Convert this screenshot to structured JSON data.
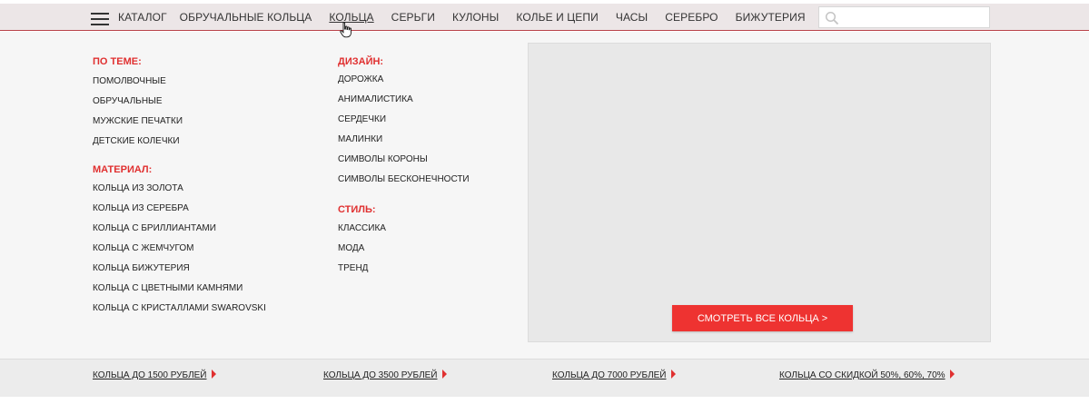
{
  "nav": {
    "catalog_label": "КАТАЛОГ",
    "items": [
      {
        "label": "ОБРУЧАЛЬНЫЕ КОЛЬЦА"
      },
      {
        "label": "КОЛЬЦА"
      },
      {
        "label": "СЕРЬГИ"
      },
      {
        "label": "КУЛОНЫ"
      },
      {
        "label": "КОЛЬЕ И ЦЕПИ"
      },
      {
        "label": "ЧАСЫ"
      },
      {
        "label": "СЕРЕБРО"
      },
      {
        "label": "БИЖУТЕРИЯ"
      }
    ],
    "active_item": "КОЛЬЦА"
  },
  "search": {
    "value": "",
    "placeholder": ""
  },
  "menu": {
    "theme": {
      "heading": "ПО ТЕМЕ:",
      "items": [
        "ПОМОЛВОЧНЫЕ",
        "ОБРУЧАЛЬНЫЕ",
        "МУЖСКИЕ ПЕЧАТКИ",
        "ДЕТСКИЕ КОЛЕЧКИ"
      ]
    },
    "material": {
      "heading": "МАТЕРИАЛ:",
      "items": [
        "КОЛЬЦА ИЗ ЗОЛОТА",
        "КОЛЬЦА ИЗ СЕРЕБРА",
        "КОЛЬЦА С БРИЛЛИАНТАМИ",
        "КОЛЬЦА С ЖЕМЧУГОМ",
        "КОЛЬЦА БИЖУТЕРИЯ",
        "КОЛЬЦА С ЦВЕТНЫМИ КАМНЯМИ",
        "КОЛЬЦА С КРИСТАЛЛАМИ SWAROVSKI"
      ]
    },
    "design": {
      "heading": "ДИЗАЙН:",
      "items": [
        "ДОРОЖКА",
        "АНИМАЛИСТИКА",
        "СЕРДЕЧКИ",
        "МАЛИНКИ",
        "СИМВОЛЫ КОРОНЫ",
        "СИМВОЛЫ  БЕСКОНЕЧНОСТИ"
      ]
    },
    "style": {
      "heading": "СТИЛЬ:",
      "items": [
        "КЛАССИКА",
        "МОДА",
        "ТРЕНД"
      ]
    }
  },
  "promo": {
    "button_label": "СМОТРЕТЬ ВСЕ  КОЛЬЦА >"
  },
  "price_links": [
    "КОЛЬЦА ДО 1500 РУБЛЕЙ",
    "КОЛЬЦА ДО 3500 РУБЛЕЙ",
    "КОЛЬЦА ДО 7000 РУБЛЕЙ",
    "КОЛЬЦА СО СКИДКОЙ 50%, 60%, 70%"
  ],
  "colors": {
    "accent": "#e03030",
    "button": "#ee3331",
    "topbar": "#ece6e7",
    "dropdown_bg": "#f6f6f6"
  }
}
